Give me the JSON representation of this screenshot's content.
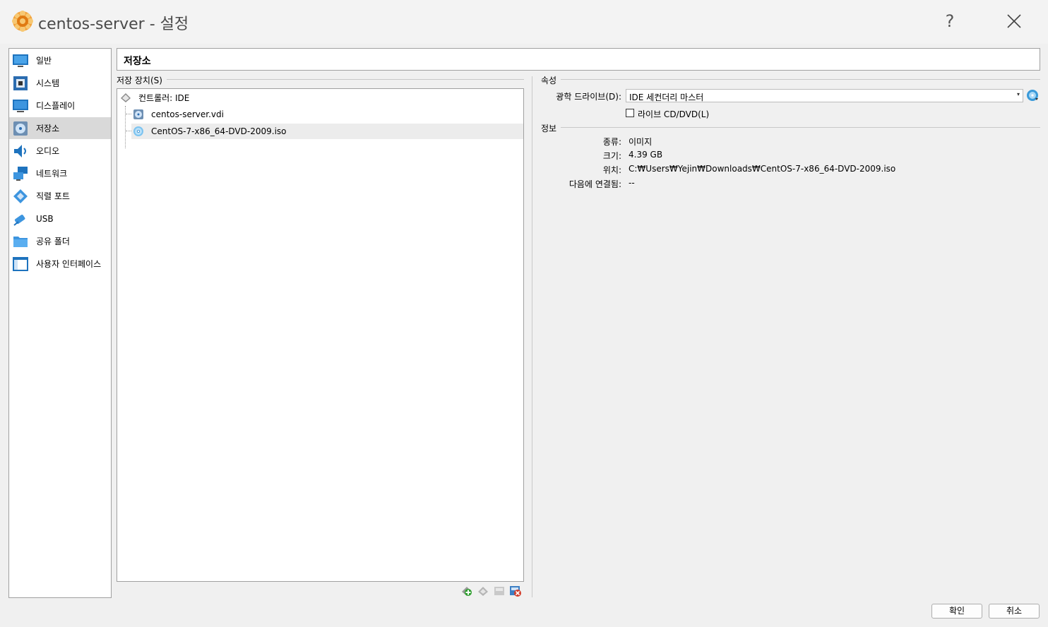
{
  "window": {
    "title": "centos-server - 설정",
    "help_label": "?"
  },
  "sidebar": {
    "items": [
      {
        "label": "일반",
        "icon": "general-icon"
      },
      {
        "label": "시스템",
        "icon": "system-icon"
      },
      {
        "label": "디스플레이",
        "icon": "display-icon"
      },
      {
        "label": "저장소",
        "icon": "storage-icon",
        "selected": true
      },
      {
        "label": "오디오",
        "icon": "audio-icon"
      },
      {
        "label": "네트워크",
        "icon": "network-icon"
      },
      {
        "label": "직렬 포트",
        "icon": "serial-port-icon"
      },
      {
        "label": "USB",
        "icon": "usb-icon"
      },
      {
        "label": "공유 폴더",
        "icon": "shared-folder-icon"
      },
      {
        "label": "사용자 인터페이스",
        "icon": "user-interface-icon"
      }
    ]
  },
  "page": {
    "title": "저장소"
  },
  "storage_devices": {
    "group_title": "저장 장치(S)",
    "controller": "컨트롤러: IDE",
    "attachments": [
      {
        "label": "centos-server.vdi",
        "icon": "hard-disk-icon"
      },
      {
        "label": "CentOS-7-x86_64-DVD-2009.iso",
        "icon": "optical-disc-icon",
        "selected": true
      }
    ]
  },
  "attributes": {
    "group_title": "속성",
    "optical_drive_label": "광학 드라이브(D):",
    "optical_drive_value": "IDE 세컨더리 마스터",
    "live_cd_label": "라이브 CD/DVD(L)",
    "live_cd_checked": false
  },
  "information": {
    "group_title": "정보",
    "type_label": "종류:",
    "type_value": "이미지",
    "size_label": "크기:",
    "size_value": "4.39 GB",
    "location_label": "위치:",
    "location_value": "C:₩Users₩Yejin₩Downloads₩CentOS-7-x86_64-DVD-2009.iso",
    "attached_label": "다음에 연결됨:",
    "attached_value": "--"
  },
  "buttons": {
    "ok": "확인",
    "cancel": "취소"
  },
  "colors": {
    "accent": "#1e73be",
    "selection": "#d9d9d9",
    "add_green": "#2e9e2e",
    "remove_red": "#d23c2a"
  }
}
